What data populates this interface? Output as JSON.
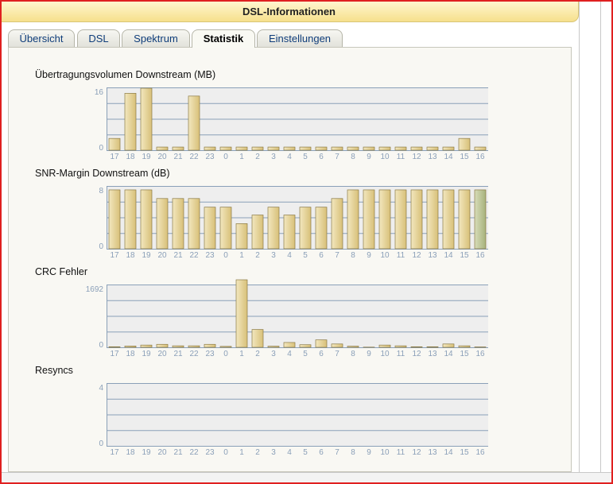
{
  "window": {
    "title": "DSL-Informationen"
  },
  "tabs": [
    {
      "label": "Übersicht",
      "active": false
    },
    {
      "label": "DSL",
      "active": false
    },
    {
      "label": "Spektrum",
      "active": false
    },
    {
      "label": "Statistik",
      "active": true
    },
    {
      "label": "Einstellungen",
      "active": false
    }
  ],
  "colors": {
    "bar_fill": "#d8c078",
    "bar_fill_light": "#f2e7bf",
    "bar_fill_last": "#a6b27c",
    "plot_bg": "#eeeeee",
    "grid": "#8aa0b8",
    "tick_label": "#8a9fb8"
  },
  "chart_data": [
    {
      "type": "bar",
      "title": "Übertragungsvolumen Downstream (MB)",
      "categories": [
        "17",
        "18",
        "19",
        "20",
        "21",
        "22",
        "23",
        "0",
        "1",
        "2",
        "3",
        "4",
        "5",
        "6",
        "7",
        "8",
        "9",
        "10",
        "11",
        "12",
        "13",
        "14",
        "15",
        "16"
      ],
      "values": [
        3,
        14.5,
        15.8,
        0.8,
        0.8,
        13.8,
        0.8,
        0.8,
        0.8,
        0.8,
        0.8,
        0.8,
        0.8,
        0.8,
        0.8,
        0.8,
        0.8,
        0.8,
        0.8,
        0.8,
        0.8,
        0.8,
        3,
        0.8
      ],
      "ylim": [
        0,
        16
      ],
      "yticks": [
        "0",
        "16"
      ],
      "grid": true
    },
    {
      "type": "bar",
      "title": "SNR-Margin Downstream (dB)",
      "categories": [
        "17",
        "18",
        "19",
        "20",
        "21",
        "22",
        "23",
        "0",
        "1",
        "2",
        "3",
        "4",
        "5",
        "6",
        "7",
        "8",
        "9",
        "10",
        "11",
        "12",
        "13",
        "14",
        "15",
        "16"
      ],
      "values": [
        7.5,
        7.5,
        7.5,
        6.4,
        6.4,
        6.4,
        5.3,
        5.3,
        3.2,
        4.3,
        5.3,
        4.3,
        5.3,
        5.3,
        6.4,
        7.5,
        7.5,
        7.5,
        7.5,
        7.5,
        7.5,
        7.5,
        7.5,
        7.5
      ],
      "ylim": [
        0,
        8
      ],
      "yticks": [
        "0",
        "8"
      ],
      "grid": true
    },
    {
      "type": "bar",
      "title": "CRC Fehler",
      "categories": [
        "17",
        "18",
        "19",
        "20",
        "21",
        "22",
        "23",
        "0",
        "1",
        "2",
        "3",
        "4",
        "5",
        "6",
        "7",
        "8",
        "9",
        "10",
        "11",
        "12",
        "13",
        "14",
        "15",
        "16"
      ],
      "values": [
        15,
        35,
        60,
        80,
        40,
        40,
        80,
        25,
        1820,
        480,
        30,
        130,
        70,
        200,
        90,
        30,
        5,
        60,
        40,
        15,
        15,
        90,
        40,
        10
      ],
      "ylim": [
        0,
        1692
      ],
      "yticks": [
        "0",
        "1692"
      ],
      "grid": true
    },
    {
      "type": "bar",
      "title": "Resyncs",
      "categories": [
        "17",
        "18",
        "19",
        "20",
        "21",
        "22",
        "23",
        "0",
        "1",
        "2",
        "3",
        "4",
        "5",
        "6",
        "7",
        "8",
        "9",
        "10",
        "11",
        "12",
        "13",
        "14",
        "15",
        "16"
      ],
      "values": [
        0,
        0,
        0,
        0,
        0,
        0,
        0,
        0,
        0,
        0,
        0,
        0,
        0,
        0,
        0,
        0,
        0,
        0,
        0,
        0,
        0,
        0,
        0,
        0
      ],
      "ylim": [
        0,
        4
      ],
      "yticks": [
        "0",
        "4"
      ],
      "grid": true
    }
  ]
}
